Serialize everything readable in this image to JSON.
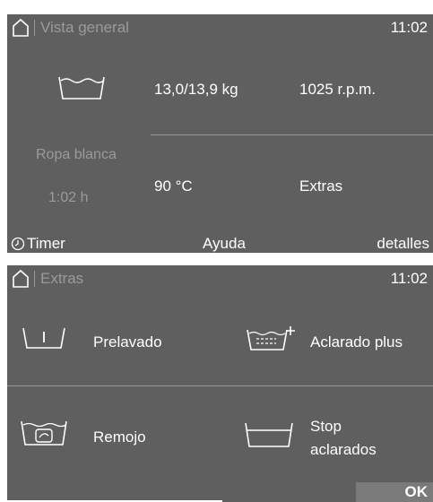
{
  "overview": {
    "title": "Vista general",
    "time": "11:02",
    "load": "13,0/13,9 kg",
    "spin": "1025 r.p.m.",
    "temperature": "90 °C",
    "extras": "Extras",
    "program": "Ropa blanca",
    "duration": "1:02  h",
    "bottom": {
      "timer": "Timer",
      "help": "Ayuda",
      "details": "detalles"
    }
  },
  "extras_screen": {
    "title": "Extras",
    "time": "11:02",
    "options": [
      {
        "label": "Prelavado",
        "icon": "prewash-icon"
      },
      {
        "label": "Aclarado plus",
        "icon": "rinse-plus-icon"
      },
      {
        "label": "Remojo",
        "icon": "soak-icon"
      },
      {
        "label": "Stop aclarados",
        "label_line1": "Stop",
        "label_line2": "aclarados",
        "icon": "rinse-stop-icon"
      }
    ],
    "ok": "OK"
  }
}
